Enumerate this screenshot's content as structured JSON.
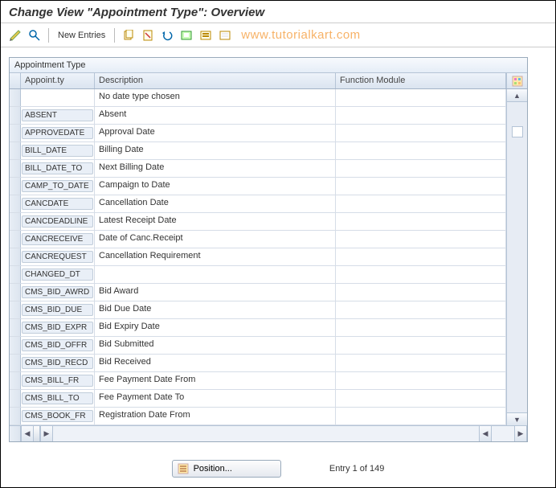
{
  "title": "Change View \"Appointment Type\": Overview",
  "toolbar": {
    "new_entries_label": "New Entries"
  },
  "watermark": "www.tutorialkart.com",
  "section_title": "Appointment Type",
  "columns": {
    "appoint_ty": "Appoint.ty",
    "description": "Description",
    "function_module": "Function Module"
  },
  "rows": [
    {
      "type": "",
      "desc": "No date type chosen",
      "func": ""
    },
    {
      "type": "ABSENT",
      "desc": "Absent",
      "func": ""
    },
    {
      "type": "APPROVEDATE",
      "desc": "Approval Date",
      "func": ""
    },
    {
      "type": "BILL_DATE",
      "desc": "Billing Date",
      "func": ""
    },
    {
      "type": "BILL_DATE_TO",
      "desc": "Next Billing Date",
      "func": ""
    },
    {
      "type": "CAMP_TO_DATE",
      "desc": "Campaign to Date",
      "func": ""
    },
    {
      "type": "CANCDATE",
      "desc": "Cancellation Date",
      "func": ""
    },
    {
      "type": "CANCDEADLINE",
      "desc": "Latest Receipt Date",
      "func": ""
    },
    {
      "type": "CANCRECEIVE",
      "desc": "Date of Canc.Receipt",
      "func": ""
    },
    {
      "type": "CANCREQUEST",
      "desc": "Cancellation Requirement",
      "func": ""
    },
    {
      "type": "CHANGED_DT",
      "desc": "",
      "func": ""
    },
    {
      "type": "CMS_BID_AWRD",
      "desc": "Bid Award",
      "func": ""
    },
    {
      "type": "CMS_BID_DUE",
      "desc": "Bid Due Date",
      "func": ""
    },
    {
      "type": "CMS_BID_EXPR",
      "desc": "Bid Expiry Date",
      "func": ""
    },
    {
      "type": "CMS_BID_OFFR",
      "desc": "Bid Submitted",
      "func": ""
    },
    {
      "type": "CMS_BID_RECD",
      "desc": "Bid Received",
      "func": ""
    },
    {
      "type": "CMS_BILL_FR",
      "desc": "Fee Payment Date From",
      "func": ""
    },
    {
      "type": "CMS_BILL_TO",
      "desc": "Fee Payment Date To",
      "func": ""
    },
    {
      "type": "CMS_BOOK_FR",
      "desc": "Registration Date From",
      "func": ""
    }
  ],
  "footer": {
    "position_label": "Position...",
    "entry_info": "Entry 1 of 149"
  }
}
